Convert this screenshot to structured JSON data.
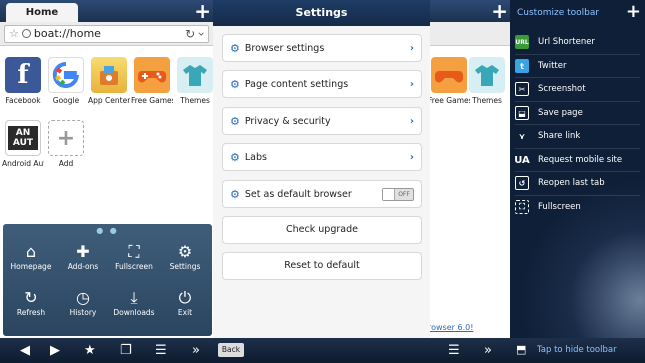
{
  "browser": {
    "tab_label": "Home",
    "url": "boat://home",
    "tiles": [
      {
        "label": "Facebook",
        "icon": "facebook-icon",
        "color": "#3b5998",
        "glyph": "f"
      },
      {
        "label": "Google",
        "icon": "google-icon",
        "color": "#ffffff",
        "glyph": "g"
      },
      {
        "label": "App Center",
        "icon": "app-center-icon",
        "color": "#f0c040",
        "glyph": "★"
      },
      {
        "label": "Free Games",
        "icon": "free-games-icon",
        "color": "#f07020",
        "glyph": "🎮"
      },
      {
        "label": "Themes",
        "icon": "themes-icon",
        "color": "#40b0c0",
        "glyph": "👕"
      },
      {
        "label": "Android Aut...",
        "icon": "android-auto-icon",
        "color": "#2a2a2a",
        "glyph": "AN"
      },
      {
        "label": "Add",
        "icon": "add-icon",
        "color": "#ffffff",
        "glyph": "+"
      }
    ],
    "menu": [
      {
        "label": "Homepage",
        "glyph": "⌂"
      },
      {
        "label": "Add-ons",
        "glyph": "✚"
      },
      {
        "label": "Fullscreen",
        "glyph": "⛶"
      },
      {
        "label": "Settings",
        "glyph": "⚙"
      },
      {
        "label": "Refresh",
        "glyph": "↻"
      },
      {
        "label": "History",
        "glyph": "◷"
      },
      {
        "label": "Downloads",
        "glyph": "⤓"
      },
      {
        "label": "Exit",
        "glyph": "⏻"
      }
    ]
  },
  "settings": {
    "title": "Settings",
    "items": [
      {
        "label": "Browser settings"
      },
      {
        "label": "Page content settings"
      },
      {
        "label": "Privacy & security"
      },
      {
        "label": "Labs"
      }
    ],
    "default_browser": {
      "label": "Set as default browser",
      "state": "OFF"
    },
    "check_upgrade": "Check upgrade",
    "reset": "Reset to default"
  },
  "background": {
    "link_fragment": "rowser 6.0!"
  },
  "toolbar_panel": {
    "title": "Customize toolbar",
    "items": [
      {
        "label": "Url Shortener",
        "icon": "url-shortener-icon"
      },
      {
        "label": "Twitter",
        "icon": "twitter-icon"
      },
      {
        "label": "Screenshot",
        "icon": "screenshot-icon"
      },
      {
        "label": "Save page",
        "icon": "save-page-icon"
      },
      {
        "label": "Share link",
        "icon": "share-link-icon"
      },
      {
        "label": "Request mobile site",
        "icon": "request-mobile-site-icon"
      },
      {
        "label": "Reopen last tab",
        "icon": "reopen-last-tab-icon"
      },
      {
        "label": "Fullscreen",
        "icon": "fullscreen-icon"
      }
    ],
    "hide_label": "Tap to hide toolbar"
  },
  "bottom_bar": {
    "back_label": "Back"
  }
}
